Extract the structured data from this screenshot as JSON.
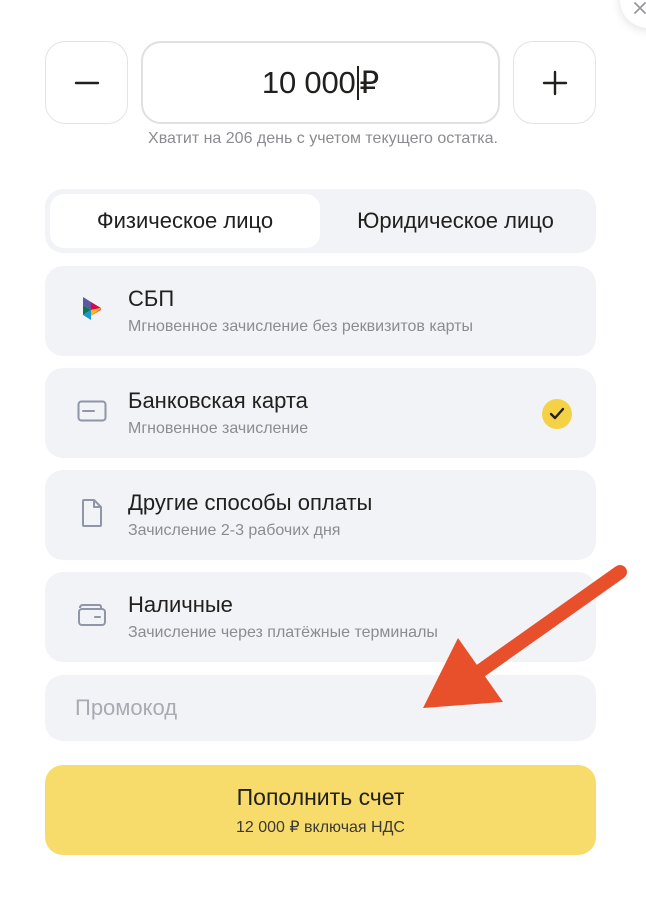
{
  "amount": {
    "value_number": "10 000",
    "currency": "₽",
    "minus_symbol": "−",
    "plus_symbol": "+",
    "hint": "Хватит на 206 день с учетом текущего остатка."
  },
  "payer_type": {
    "tabs": [
      {
        "label": "Физическое лицо",
        "active": true
      },
      {
        "label": "Юридическое лицо",
        "active": false
      }
    ]
  },
  "payment_methods": [
    {
      "title": "СБП",
      "subtitle": "Мгновенное зачисление без реквизитов карты",
      "icon": "sbp-logo-icon",
      "selected": false
    },
    {
      "title": "Банковская карта",
      "subtitle": "Мгновенное зачисление",
      "icon": "credit-card-icon",
      "selected": true
    },
    {
      "title": "Другие способы оплаты",
      "subtitle": "Зачисление 2-3 рабочих дня",
      "icon": "document-icon",
      "selected": false
    },
    {
      "title": "Наличные",
      "subtitle": "Зачисление через платёжные терминалы",
      "icon": "wallet-icon",
      "selected": false
    }
  ],
  "promo": {
    "placeholder": "Промокод"
  },
  "submit": {
    "label": "Пополнить счет",
    "sublabel": "12 000 ₽ включая НДС"
  },
  "colors": {
    "accent": "#f8dc6b",
    "check": "#f5d245",
    "annotation_arrow": "#e8502c",
    "card_bg": "#f2f3f6"
  }
}
